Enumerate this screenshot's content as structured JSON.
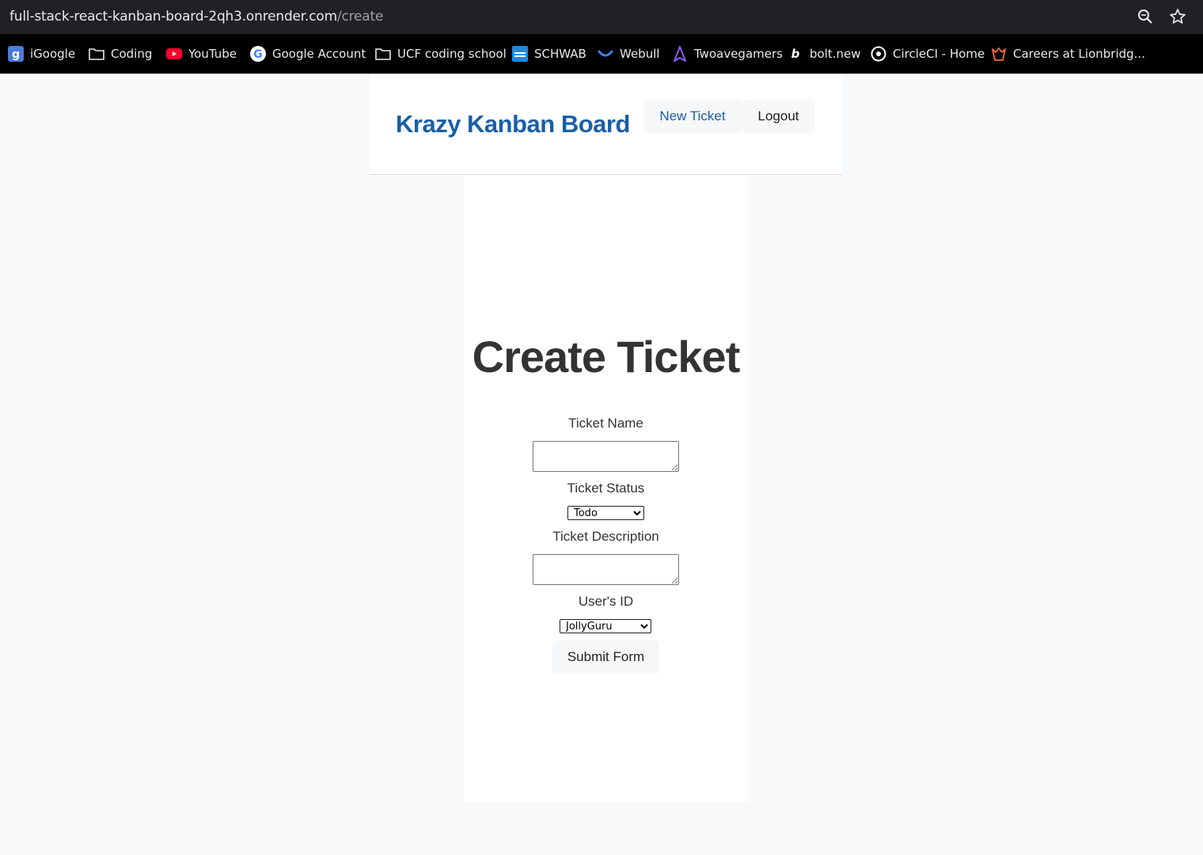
{
  "browser": {
    "url_host": "full-stack-react-kanban-board-2qh3.onrender.com",
    "url_path": "/create",
    "bookmarks": [
      {
        "label": "iGoogle",
        "icon": "igoogle-icon"
      },
      {
        "label": "Coding",
        "icon": "folder-icon"
      },
      {
        "label": "YouTube",
        "icon": "youtube-icon"
      },
      {
        "label": "Google Account",
        "icon": "google-icon"
      },
      {
        "label": "UCF coding school",
        "icon": "folder-icon"
      },
      {
        "label": "SCHWAB",
        "icon": "schwab-icon"
      },
      {
        "label": "Webull",
        "icon": "webull-icon"
      },
      {
        "label": "Twoavegamers",
        "icon": "twoavegamers-icon"
      },
      {
        "label": "bolt.new",
        "icon": "bolt-icon"
      },
      {
        "label": "CircleCI - Home",
        "icon": "circleci-icon"
      },
      {
        "label": "Careers at Lionbridg...",
        "icon": "lionbridge-icon"
      }
    ]
  },
  "header": {
    "brand": "Krazy Kanban Board",
    "new_ticket": "New Ticket",
    "logout": "Logout"
  },
  "form": {
    "title": "Create Ticket",
    "name_label": "Ticket Name",
    "status_label": "Ticket Status",
    "status_value": "Todo",
    "description_label": "Ticket Description",
    "user_label": "User's ID",
    "user_value": "JollyGuru",
    "submit": "Submit Form"
  },
  "colors": {
    "brand": "#1a5fa8",
    "page_background": "#f8f9fa",
    "browser_bar": "#202124"
  }
}
